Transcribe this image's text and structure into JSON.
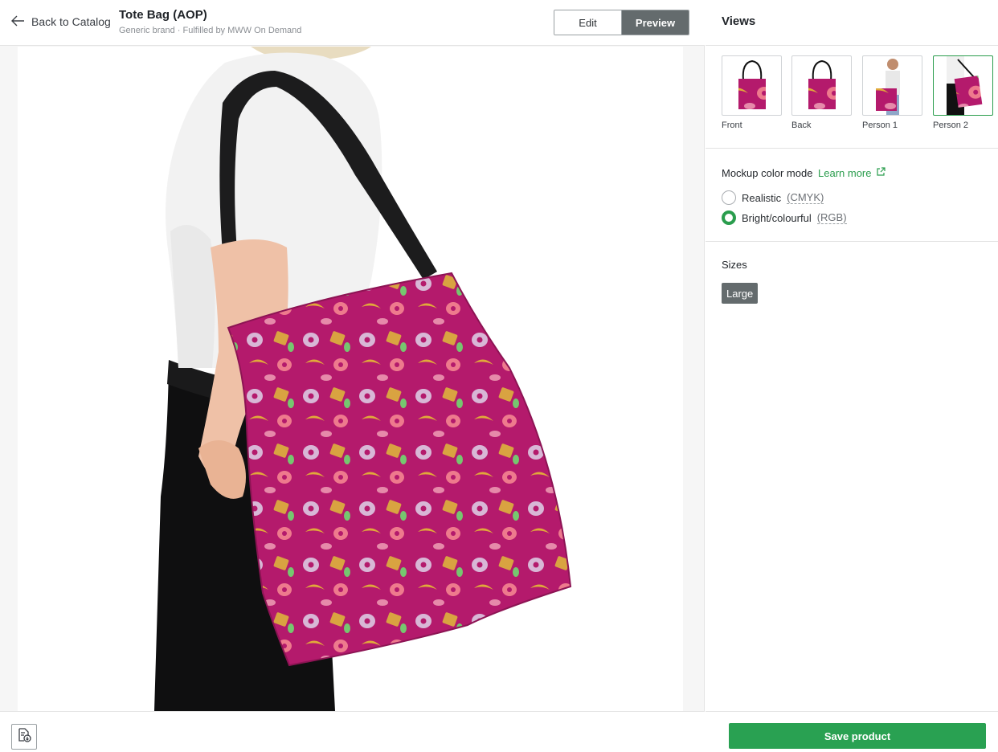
{
  "header": {
    "back_label": "Back to Catalog",
    "product_title": "Tote Bag (AOP)",
    "product_subtitle": "Generic brand · Fulfilled by MWW On Demand",
    "tabs": [
      {
        "label": "Edit",
        "active": false
      },
      {
        "label": "Preview",
        "active": true
      }
    ]
  },
  "panel": {
    "views_title": "Views",
    "views": [
      {
        "label": "Front",
        "icon": "tote-front-thumbnail",
        "active": false
      },
      {
        "label": "Back",
        "icon": "tote-back-thumbnail",
        "active": false
      },
      {
        "label": "Person 1",
        "icon": "person-holding-tote-thumbnail",
        "active": false
      },
      {
        "label": "Person 2",
        "icon": "person-shoulder-tote-thumbnail",
        "active": true
      }
    ],
    "mockup": {
      "label": "Mockup color mode",
      "learn_more": "Learn more",
      "options": [
        {
          "label": "Realistic",
          "hint": "(CMYK)",
          "selected": false
        },
        {
          "label": "Bright/colourful",
          "hint": "(RGB)",
          "selected": true
        }
      ]
    },
    "sizes_label": "Sizes",
    "sizes": [
      "Large"
    ],
    "save_label": "Save product"
  },
  "colors": {
    "accent_green": "#29a152",
    "tote_pink": "#b41a6c",
    "tab_active": "#646b6d"
  }
}
